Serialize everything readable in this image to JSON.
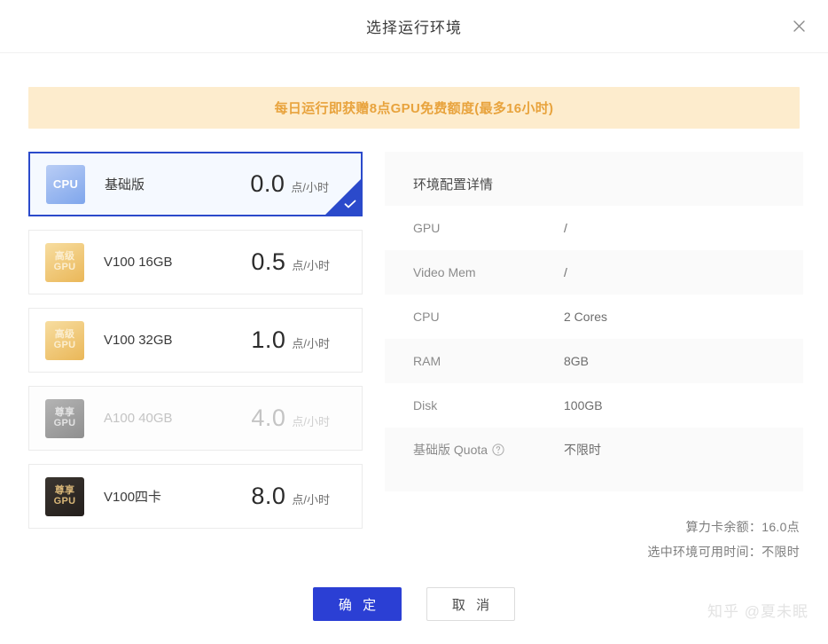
{
  "dialog": {
    "title": "选择运行环境",
    "close_icon": "close-icon"
  },
  "promo": {
    "text": "每日运行即获赠8点GPU免费额度(最多16小时)",
    "bg_color": "#fdeccd",
    "text_color": "#e8a33d"
  },
  "options": {
    "items": [
      {
        "badge_line1": "CPU",
        "badge_line2": "",
        "badge_type": "cpu",
        "name": "基础版",
        "price": "0.0",
        "unit": "点/小时",
        "selected": true,
        "disabled": false
      },
      {
        "badge_line1": "高级",
        "badge_line2": "GPU",
        "badge_type": "gpu-adv",
        "name": "V100 16GB",
        "price": "0.5",
        "unit": "点/小时",
        "selected": false,
        "disabled": false
      },
      {
        "badge_line1": "高级",
        "badge_line2": "GPU",
        "badge_type": "gpu-adv",
        "name": "V100 32GB",
        "price": "1.0",
        "unit": "点/小时",
        "selected": false,
        "disabled": false
      },
      {
        "badge_line1": "尊享",
        "badge_line2": "GPU",
        "badge_type": "gpu-pro-disabled",
        "name": "A100 40GB",
        "price": "4.0",
        "unit": "点/小时",
        "selected": false,
        "disabled": true
      },
      {
        "badge_line1": "尊享",
        "badge_line2": "GPU",
        "badge_type": "gpu-pro",
        "name": "V100四卡",
        "price": "8.0",
        "unit": "点/小时",
        "selected": false,
        "disabled": false
      }
    ],
    "selected_accent": "#2b4acb",
    "check_icon": "check-icon"
  },
  "details": {
    "title": "环境配置详情",
    "rows": [
      {
        "label": "GPU",
        "value": "/",
        "help": false
      },
      {
        "label": "Video Mem",
        "value": "/",
        "help": false
      },
      {
        "label": "CPU",
        "value": "2 Cores",
        "help": false
      },
      {
        "label": "RAM",
        "value": "8GB",
        "help": false
      },
      {
        "label": "Disk",
        "value": "100GB",
        "help": false
      },
      {
        "label": "基础版 Quota",
        "value": "不限时",
        "help": true,
        "help_icon": "question-circle-icon"
      }
    ]
  },
  "summary": {
    "balance": "算力卡余额：16.0点",
    "available_time": "选中环境可用时间：不限时"
  },
  "footer": {
    "confirm_label": "确 定",
    "cancel_label": "取 消",
    "primary_color": "#2b3fd4"
  },
  "watermark": {
    "text": "知乎 @夏未眠"
  }
}
